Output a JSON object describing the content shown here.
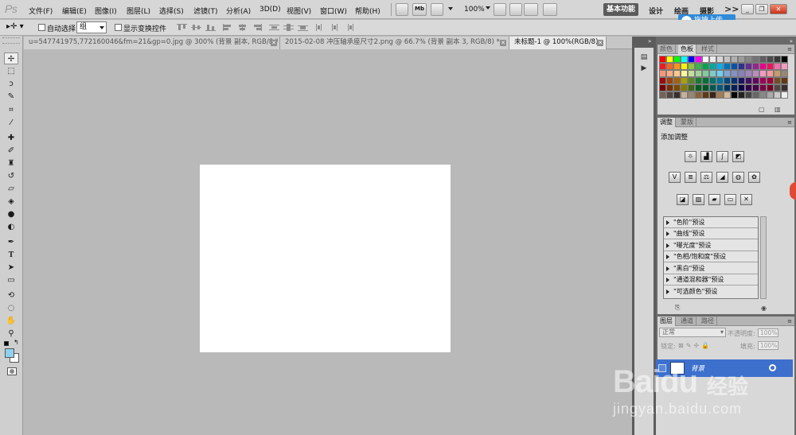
{
  "app": {
    "logo": "Ps"
  },
  "menu": [
    "文件(F)",
    "编辑(E)",
    "图像(I)",
    "图层(L)",
    "选择(S)",
    "滤镜(T)",
    "分析(A)",
    "3D(D)",
    "视图(V)",
    "窗口(W)",
    "帮助(H)"
  ],
  "appbar": {
    "zoom": "100%",
    "mb_label": "Mb"
  },
  "workspaces": {
    "active": "基本功能",
    "items": [
      "设计",
      "绘画",
      "摄影"
    ],
    "more": ">>"
  },
  "upload_badge": {
    "label": "拖拽上传"
  },
  "options": {
    "auto_select_label": "自动选择:",
    "auto_select_value": "组",
    "show_transform_label": "显示变换控件",
    "auto_select_checked": false,
    "show_transform_checked": false
  },
  "doc_tabs": [
    {
      "title": "u=547741975,772160046&fm=21&gp=0.jpg @ 300% (背景 副本, RGB/8#) *",
      "active": false
    },
    {
      "title": "2015-02-08 冲压轴承座尺寸2.png @ 66.7% (背景 副本 3, RGB/8) *",
      "active": false
    },
    {
      "title": "未标题-1 @ 100%(RGB/8)",
      "active": true
    }
  ],
  "tools": {
    "foreground_color": "#8fd0ef",
    "background_color": "#ffffff"
  },
  "swatches_panel": {
    "tabs": [
      "颜色",
      "色板",
      "样式"
    ],
    "active_tab": "色板",
    "colors": [
      "#ff0000",
      "#ffff00",
      "#00ff00",
      "#00ffff",
      "#0000ff",
      "#ff00ff",
      "#ffffff",
      "#ebebeb",
      "#d7d7d7",
      "#c3c3c3",
      "#afafaf",
      "#9b9b9b",
      "#878787",
      "#737373",
      "#5f5f5f",
      "#4b4b4b",
      "#373737",
      "#000000",
      "#ed1c24",
      "#f26522",
      "#f7941d",
      "#fff200",
      "#8dc63f",
      "#39b54a",
      "#00a651",
      "#00a99d",
      "#00aeef",
      "#0072bc",
      "#0054a6",
      "#2e3192",
      "#662d91",
      "#92278f",
      "#ec008c",
      "#ed145b",
      "#f06eaa",
      "#f49ac1",
      "#f7977a",
      "#f9ad81",
      "#fdc68a",
      "#fff799",
      "#c4df9b",
      "#a3d39c",
      "#82ca9d",
      "#7bcdc8",
      "#6dcff6",
      "#7da7d9",
      "#8393ca",
      "#8781bd",
      "#a187be",
      "#bd8cbf",
      "#f49ac2",
      "#f6989d",
      "#c69c6d",
      "#998675",
      "#9e0b0f",
      "#a0410d",
      "#a3620a",
      "#aba000",
      "#598527",
      "#1a7b30",
      "#007236",
      "#00746b",
      "#0076a3",
      "#004a80",
      "#003471",
      "#1b1464",
      "#440e62",
      "#630460",
      "#9e005d",
      "#9e0039",
      "#754c24",
      "#603913",
      "#790000",
      "#7b2e00",
      "#7d4900",
      "#827b00",
      "#406618",
      "#005e20",
      "#005826",
      "#005952",
      "#005b7f",
      "#003663",
      "#002157",
      "#0d004c",
      "#32004b",
      "#4b0049",
      "#7b0046",
      "#7a0026",
      "#534741",
      "#362f2d",
      "#736357",
      "#534741",
      "#362f2d",
      "#c7b299",
      "#998675",
      "#8c6239",
      "#603913",
      "#3c2415",
      "#a67c52",
      "#d4b896",
      "#000000",
      "#222222",
      "#444444",
      "#666666",
      "#888888",
      "#aaaaaa",
      "#cccccc",
      "#eeeeee"
    ]
  },
  "adjustments_panel": {
    "tabs": [
      "调整",
      "蒙版"
    ],
    "active_tab": "调整",
    "title": "添加调整",
    "presets": [
      "\"色阶\"预设",
      "\"曲线\"预设",
      "\"曝光度\"预设",
      "\"色相/饱和度\"预设",
      "\"黑白\"预设",
      "\"通道混和器\"预设",
      "\"可选颜色\"预设"
    ]
  },
  "layers_panel": {
    "tabs": [
      "图层",
      "通道",
      "路径"
    ],
    "active_tab": "图层",
    "blend_mode": "正常",
    "opacity_label": "不透明度:",
    "opacity_value": "100%",
    "lock_label": "锁定:",
    "fill_label": "填充:",
    "fill_value": "100%",
    "layer_name": "背景"
  },
  "watermark": {
    "logo": "Baidu",
    "cn": "经验",
    "url": "jingyan.baidu.com"
  }
}
